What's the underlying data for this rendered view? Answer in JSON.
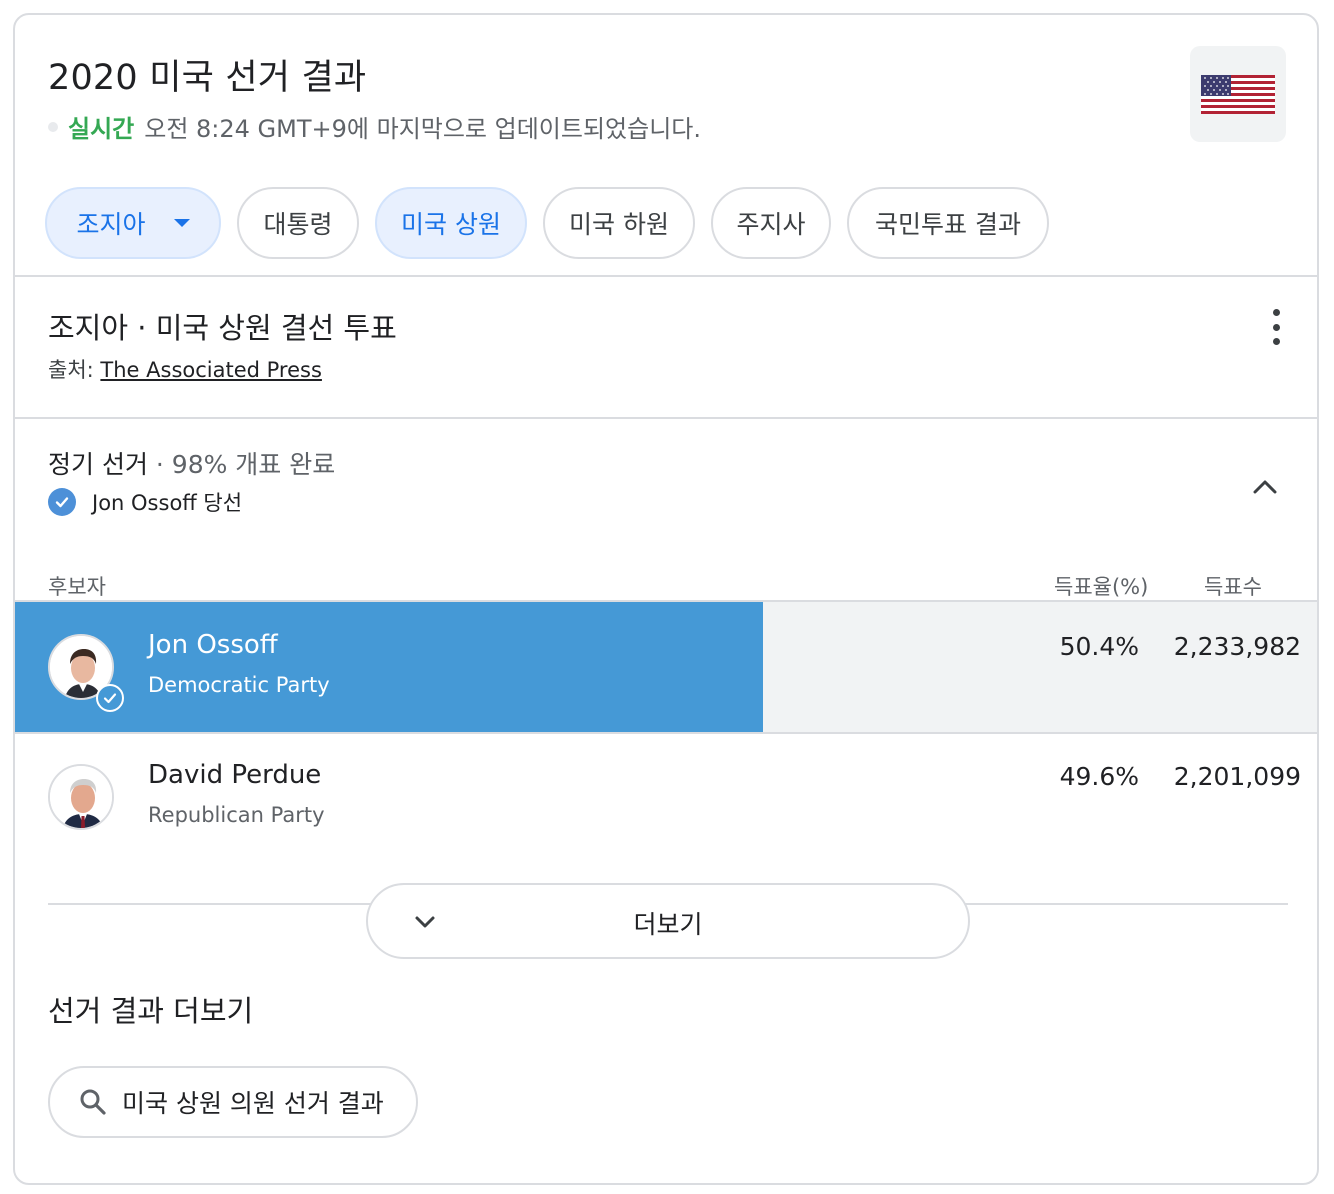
{
  "header": {
    "title": "2020 미국 선거 결과",
    "live_label": "실시간",
    "updated_text": "오전 8:24 GMT+9에 마지막으로 업데이트되었습니다.",
    "flag_icon": "us-flag-icon"
  },
  "tabs": [
    {
      "label": "조지아",
      "selected": true
    },
    {
      "label": "대통령",
      "selected": false
    },
    {
      "label": "미국 상원",
      "selected": true
    },
    {
      "label": "미국 하원",
      "selected": false
    },
    {
      "label": "주지사",
      "selected": false
    },
    {
      "label": "국민투표 결과",
      "selected": false
    }
  ],
  "section": {
    "title": "조지아 · 미국 상원 결선 투표",
    "source_label": "출처:",
    "source_name": "The Associated Press"
  },
  "race": {
    "name": "정기 선거",
    "reporting": " · 98% 개표 완료",
    "winner_text": "Jon Ossoff 당선"
  },
  "columns": {
    "candidate": "후보자",
    "percent": "득표율(%)",
    "votes": "득표수"
  },
  "candidates": [
    {
      "name": "Jon Ossoff",
      "party": "Democratic Party",
      "percent": "50.4%",
      "votes": "2,233,982",
      "share": 0.504,
      "winner": true,
      "color": "#4599d6"
    },
    {
      "name": "David Perdue",
      "party": "Republican Party",
      "percent": "49.6%",
      "votes": "2,201,099",
      "share": 0.496,
      "winner": false
    }
  ],
  "more_button": {
    "label": "더보기"
  },
  "more_results": {
    "heading": "선거 결과 더보기",
    "search_label": "미국 상원 의원 선거 결과"
  }
}
